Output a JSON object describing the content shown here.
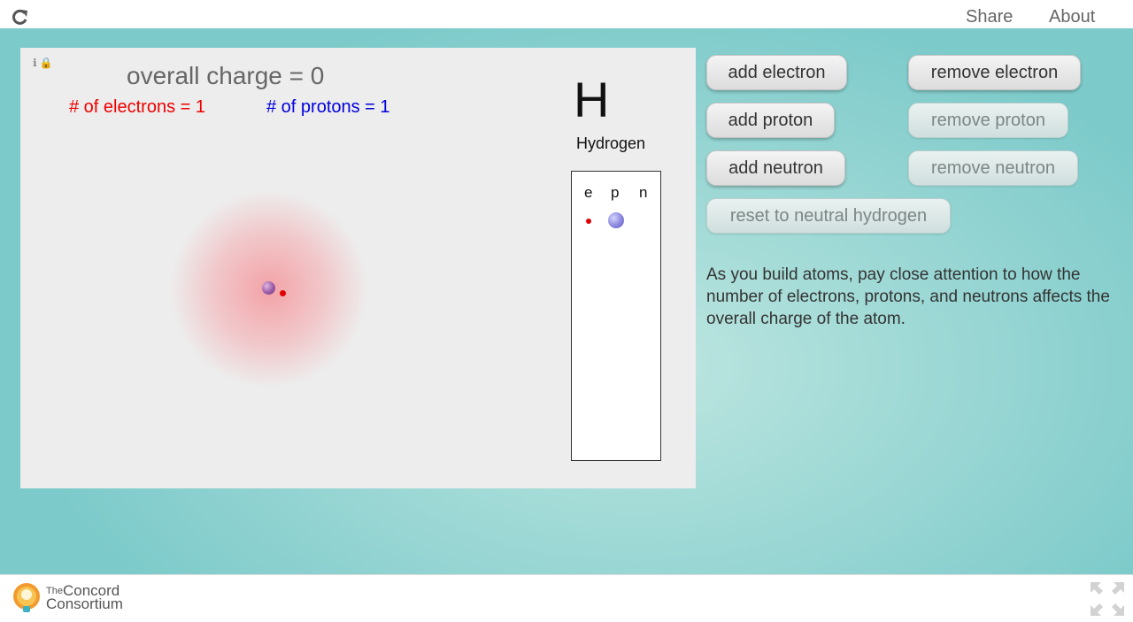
{
  "topbar": {
    "share_label": "Share",
    "about_label": "About",
    "reload_icon": "reload-icon"
  },
  "model": {
    "overall_charge": "overall charge = 0",
    "electron_count": "# of electrons = 1",
    "proton_count": "# of protons = 1",
    "element_symbol": "H",
    "element_name": "Hydrogen",
    "particle_headers": [
      "e",
      "p",
      "n"
    ]
  },
  "controls": {
    "add_electron": "add electron",
    "remove_electron": "remove electron",
    "add_proton": "add proton",
    "remove_proton": "remove proton",
    "add_neutron": "add neutron",
    "remove_neutron": "remove neutron",
    "reset": "reset to neutral hydrogen"
  },
  "instructions": "As you build atoms, pay close attention to how the number of electrons, protons, and neutrons affects the overall charge of the atom.",
  "footer": {
    "logo_line1_small": "The",
    "logo_line1_big": "Concord",
    "logo_line2": "Consortium"
  },
  "colors": {
    "electron": "#e00000",
    "proton_label": "#0000dd",
    "background": "#7ccaca"
  }
}
